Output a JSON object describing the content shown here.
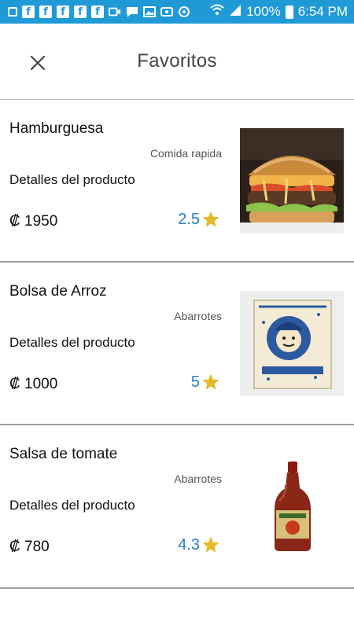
{
  "status_bar": {
    "battery": "100%",
    "time": "6:54 PM"
  },
  "header": {
    "title": "Favoritos"
  },
  "products": [
    {
      "name": "Hamburguesa",
      "category": "Comida rapida",
      "details": "Detalles del producto",
      "price": "₡ 1950",
      "rating": "2.5",
      "image": "hamburger"
    },
    {
      "name": "Bolsa de Arroz",
      "category": "Abarrotes",
      "details": "Detalles del producto",
      "price": "₡ 1000",
      "rating": "5",
      "image": "rice-bag"
    },
    {
      "name": "Salsa de tomate",
      "category": "Abarrotes",
      "details": "Detalles del producto",
      "price": "₡ 780",
      "rating": "4.3",
      "image": "sauce-bottle"
    }
  ],
  "colors": {
    "status_bar": "#1f9ad6",
    "rating_text": "#2a7fc2",
    "star": "#e4b92b"
  }
}
